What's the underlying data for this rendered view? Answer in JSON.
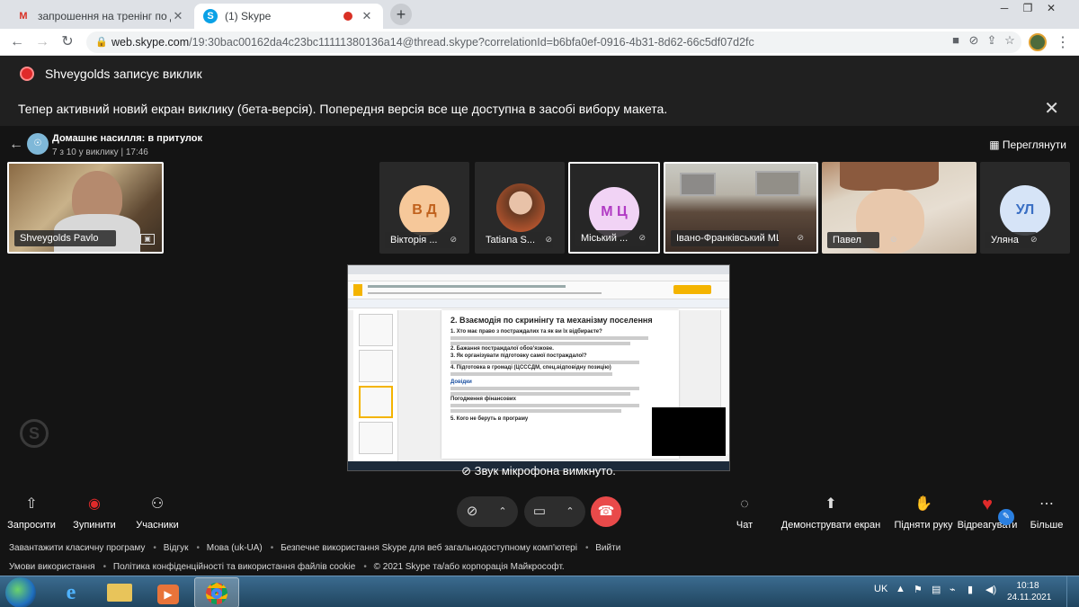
{
  "browser": {
    "tabs": [
      {
        "title": "запрошення на тренінг по дома",
        "active": false,
        "icon": "gmail-icon"
      },
      {
        "title": "(1) Skype",
        "active": true,
        "icon": "skype-icon",
        "recording": true
      }
    ],
    "url_host": "web.skype.com",
    "url_path": "/19:30bac00162da4c23bc11111380136a14@thread.skype?correlationId=b6bfa0ef-0916-4b31-8d62-66c5df07d2fc"
  },
  "recording_banner": "Shveygolds записує виклик",
  "info_banner": "Тепер активний новий екран виклику (бета-версія). Попередня версія все ще доступна в засобі вибору макета.",
  "call": {
    "title": "Домашнє насилля: в притулок",
    "subtitle": "7 з 10 у виклику | 17:46",
    "peek_label": "Переглянути"
  },
  "participants": [
    {
      "name": "Shveygolds Pavlo",
      "type": "video"
    },
    {
      "name": "Вікторія ...",
      "initials": "В Д",
      "type": "initials"
    },
    {
      "name": "Tatiana S...",
      "type": "avatar"
    },
    {
      "name": "Міський ...",
      "initials": "М Ц",
      "type": "initials"
    },
    {
      "name": "Івано-Франківський МЦ...",
      "type": "video"
    },
    {
      "name": "Павел",
      "type": "video"
    },
    {
      "name": "Уляна",
      "initials": "УЛ",
      "type": "initials"
    }
  ],
  "shared_doc": {
    "heading": "2.   Взаємодія по скринінгу та механізму поселення",
    "items": [
      "1.  Хто має право з постраждалих та як ви їх відбираєте?",
      "2.  Бажання постраждалої обов'язкове.",
      "3.  Як організувати підготовку самої постраждалої?",
      "4.  Підготовка в громаді (ЦСССДМ, спец.відповідну позицію)",
      "Довідки",
      "Погодження фінансових",
      "5.  Кого не беруть в програму"
    ]
  },
  "mute_message": "Звук мікрофона вимкнуто.",
  "controls": {
    "left": [
      "Запросити",
      "Зупинити",
      "Учасники"
    ],
    "right": [
      "Чат",
      "Демонструвати екран",
      "Підняти руку",
      "Відреагувати",
      "Більше"
    ]
  },
  "footer": {
    "row1": [
      "Завантажити класичну програму",
      "Відгук",
      "Мова (uk-UA)",
      "Безпечне використання Skype для веб загальнодоступному комп'ютері",
      "Вийти"
    ],
    "row2": [
      "Умови використання",
      "Політика конфіденційності та використання файлів cookie",
      "© 2021 Skype та/або корпорація Майкрософт."
    ]
  },
  "taskbar": {
    "language": "UK",
    "time": "10:18",
    "date": "24.11.2021"
  },
  "colors": {
    "hangup": "#e94a4a",
    "recording": "#e02a2a",
    "background": "#141414"
  }
}
